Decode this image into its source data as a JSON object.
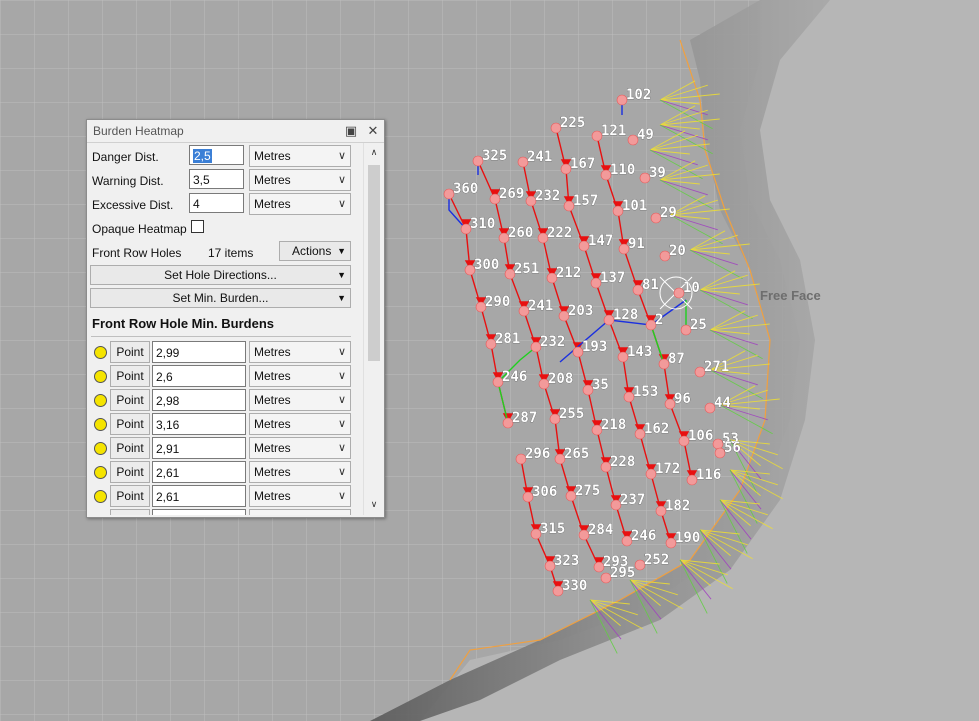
{
  "map": {
    "free_face_label": "Free Face",
    "hole_labels": [
      {
        "id": "102"
      },
      {
        "id": "225"
      },
      {
        "id": "121"
      },
      {
        "id": "49"
      },
      {
        "id": "325"
      },
      {
        "id": "241"
      },
      {
        "id": "167"
      },
      {
        "id": "110"
      },
      {
        "id": "39"
      },
      {
        "id": "360"
      },
      {
        "id": "269"
      },
      {
        "id": "232"
      },
      {
        "id": "157"
      },
      {
        "id": "101"
      },
      {
        "id": "29"
      },
      {
        "id": "310"
      },
      {
        "id": "260"
      },
      {
        "id": "222"
      },
      {
        "id": "147"
      },
      {
        "id": "91"
      },
      {
        "id": "20"
      },
      {
        "id": "300"
      },
      {
        "id": "251"
      },
      {
        "id": "212"
      },
      {
        "id": "137"
      },
      {
        "id": "81"
      },
      {
        "id": "10"
      },
      {
        "id": "290"
      },
      {
        "id": "241"
      },
      {
        "id": "203"
      },
      {
        "id": "128"
      },
      {
        "id": "2"
      },
      {
        "id": "25"
      },
      {
        "id": "281"
      },
      {
        "id": "232"
      },
      {
        "id": "193"
      },
      {
        "id": "143"
      },
      {
        "id": "87"
      },
      {
        "id": "271"
      },
      {
        "id": "246"
      },
      {
        "id": "208"
      },
      {
        "id": "35"
      },
      {
        "id": "153"
      },
      {
        "id": "96"
      },
      {
        "id": "44"
      },
      {
        "id": "287"
      },
      {
        "id": "255"
      },
      {
        "id": "218"
      },
      {
        "id": "162"
      },
      {
        "id": "106"
      },
      {
        "id": "53"
      },
      {
        "id": "296"
      },
      {
        "id": "265"
      },
      {
        "id": "56"
      },
      {
        "id": "228"
      },
      {
        "id": "172"
      },
      {
        "id": "116"
      },
      {
        "id": "306"
      },
      {
        "id": "275"
      },
      {
        "id": "237"
      },
      {
        "id": "182"
      },
      {
        "id": "315"
      },
      {
        "id": "284"
      },
      {
        "id": "246"
      },
      {
        "id": "190"
      },
      {
        "id": "323"
      },
      {
        "id": "293"
      },
      {
        "id": "252"
      },
      {
        "id": "295"
      },
      {
        "id": "330"
      }
    ]
  },
  "panel": {
    "title": "Burden Heatmap",
    "restore_icon": "restore-icon",
    "close_icon": "close-icon",
    "danger_label": "Danger Dist.",
    "danger_value": "2,5",
    "warning_label": "Warning Dist.",
    "warning_value": "3,5",
    "excessive_label": "Excessive Dist.",
    "excessive_value": "4",
    "unit_label": "Metres",
    "opaque_label": "Opaque Heatmap",
    "opaque_checked": false,
    "front_row_label": "Front Row Holes",
    "front_row_count": "17 items",
    "actions_label": "Actions",
    "set_directions_label": "Set Hole Directions...",
    "set_min_burden_label": "Set Min. Burden...",
    "section_header": "Front Row Hole Min. Burdens",
    "point_label": "Point",
    "burden_rows": [
      {
        "value": "2,99",
        "unit": "Metres"
      },
      {
        "value": "2,6",
        "unit": "Metres"
      },
      {
        "value": "2,98",
        "unit": "Metres"
      },
      {
        "value": "3,16",
        "unit": "Metres"
      },
      {
        "value": "2,91",
        "unit": "Metres"
      },
      {
        "value": "2,61",
        "unit": "Metres"
      },
      {
        "value": "2,61",
        "unit": "Metres"
      }
    ]
  }
}
